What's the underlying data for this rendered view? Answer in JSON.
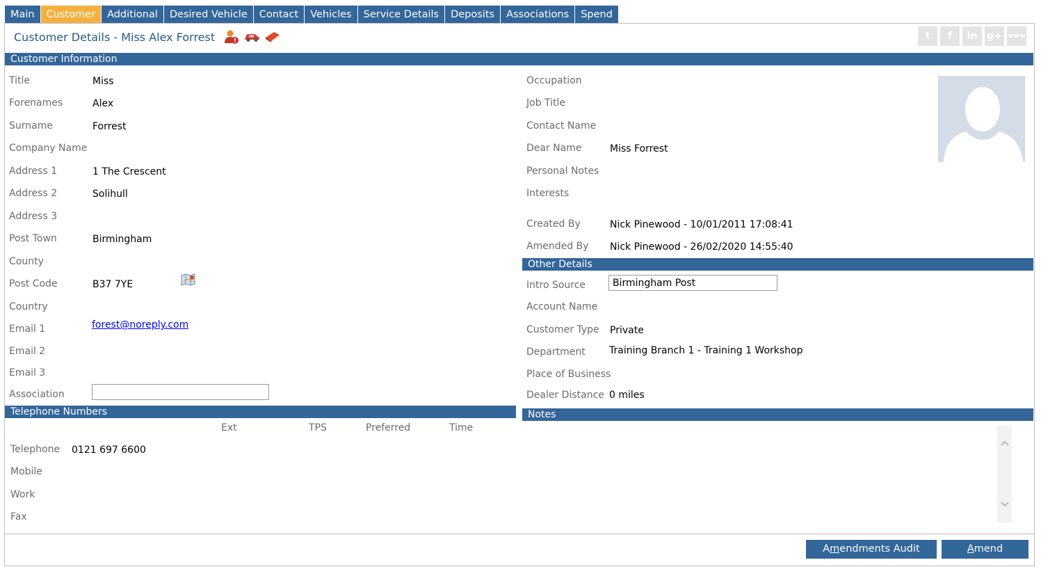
{
  "tabs": [
    "Main",
    "Customer",
    "Additional",
    "Desired Vehicle",
    "Contact",
    "Vehicles",
    "Service Details",
    "Deposits",
    "Associations",
    "Spend"
  ],
  "active_tab": "Customer",
  "page_title": "Customer Details  - Miss Alex Forrest",
  "header_icons": [
    "customer-alert-icon",
    "car-icon",
    "book-icon"
  ],
  "social_icons": [
    "twitter-icon",
    "facebook-icon",
    "linkedin-icon",
    "google-plus-icon",
    "www-icon"
  ],
  "social_glyphs": {
    "twitter": "t",
    "facebook": "f",
    "linkedin": "in",
    "google": "g+",
    "www": "www"
  },
  "customer_info": {
    "heading": "Customer Information",
    "title_label": "Title",
    "title": "Miss",
    "forenames_label": "Forenames",
    "forenames": "Alex",
    "surname_label": "Surname",
    "surname": "Forrest",
    "company_label": "Company Name",
    "company": "",
    "address1_label": "Address 1",
    "address1": "1 The Crescent",
    "address2_label": "Address 2",
    "address2": "Solihull",
    "address3_label": "Address 3",
    "address3": "",
    "post_town_label": "Post Town",
    "post_town": "Birmingham",
    "county_label": "County",
    "county": "",
    "post_code_label": "Post Code",
    "post_code": "B37 7YE",
    "country_label": "Country",
    "country": "",
    "email1_label": "Email 1",
    "email1": "forest@noreply.com",
    "email2_label": "Email 2",
    "email2": "",
    "email3_label": "Email 3",
    "email3": "",
    "association_label": "Association",
    "association": ""
  },
  "right_info": {
    "occupation_label": "Occupation",
    "occupation": "",
    "job_title_label": "Job Title",
    "job_title": "",
    "contact_name_label": "Contact Name",
    "contact_name": "",
    "dear_name_label": "Dear Name",
    "dear_name": "Miss Forrest",
    "personal_notes_label": "Personal Notes",
    "personal_notes": "",
    "interests_label": "Interests",
    "interests": "",
    "created_by_label": "Created By",
    "created_by": "Nick Pinewood - 10/01/2011 17:08:41",
    "amended_by_label": "Amended By",
    "amended_by": "Nick Pinewood - 26/02/2020 14:55:40"
  },
  "other_details": {
    "heading": "Other Details",
    "intro_source_label": "Intro Source",
    "intro_source": "Birmingham Post",
    "account_name_label": "Account Name",
    "account_name": "",
    "customer_type_label": "Customer Type",
    "customer_type": "Private",
    "department_label": "Department",
    "department": "Training Branch 1 - Training 1 Workshop",
    "place_of_business_label": "Place of Business",
    "place_of_business": "",
    "dealer_distance_label": "Dealer Distance",
    "dealer_distance": "0 miles"
  },
  "telephone": {
    "heading": "Telephone Numbers",
    "columns": [
      "Ext",
      "TPS",
      "Preferred",
      "Time"
    ],
    "rows": [
      {
        "label": "Telephone",
        "number": "0121 697 6600"
      },
      {
        "label": "Mobile",
        "number": ""
      },
      {
        "label": "Work",
        "number": ""
      },
      {
        "label": "Fax",
        "number": ""
      }
    ]
  },
  "notes": {
    "heading": "Notes"
  },
  "buttons": {
    "audit_pre": "A",
    "audit_u": "m",
    "audit_post": "endments Audit",
    "amend_pre": "",
    "amend_u": "A",
    "amend_post": "mend"
  },
  "colors": {
    "header_bar": "#336699",
    "active_tab": "#f5b041",
    "label": "#6b6b6b",
    "title": "#2a5a8a"
  }
}
